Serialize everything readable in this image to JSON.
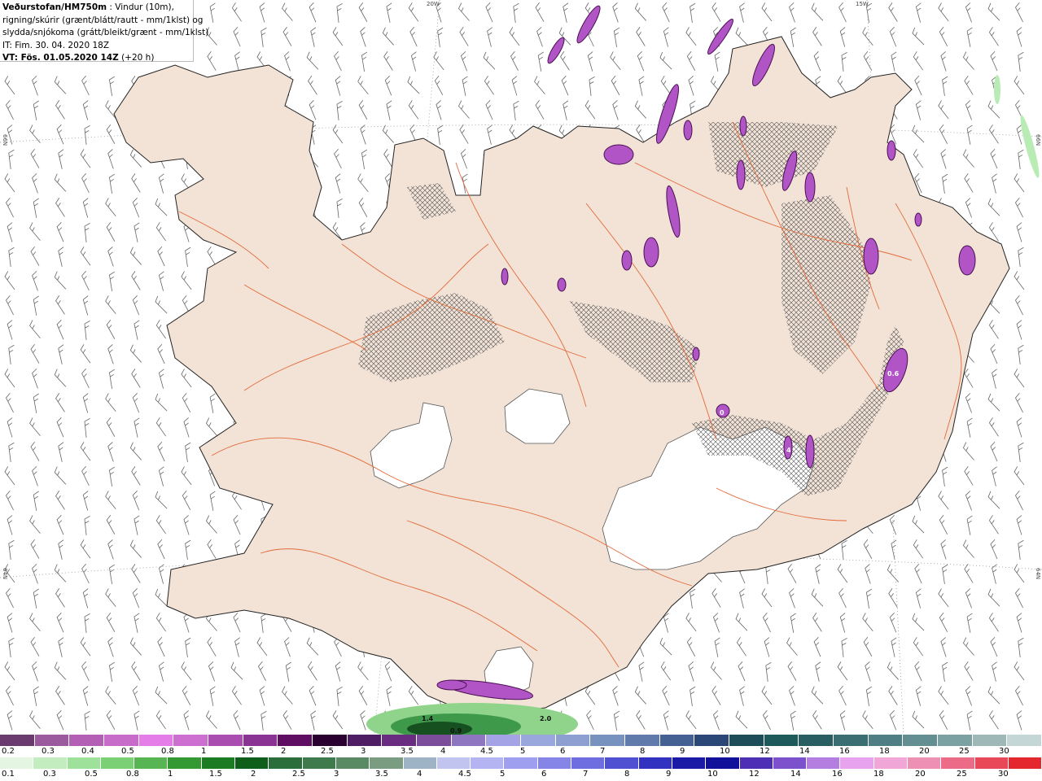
{
  "header": {
    "title": "Veðurstofan/HM750m",
    "title_rest": " : Vindur (10m),",
    "line2": "rigning/skúrir (grænt/blátt/rautt - mm/1klst) og",
    "line3": "slydda/snjókoma (grátt/bleikt/grænt - mm/1klst)",
    "line4": "IT: Fim. 30. 04. 2020 18Z",
    "line5_bold": "VT: Fös. 01.05.2020 14Z",
    "line5_rest": " (+20 h)"
  },
  "coords": {
    "lon20": "20W",
    "lon15": "15W",
    "lat66_left": "66N",
    "lat66_right": "66N",
    "lat64_left": "64N",
    "lat64_right": "64N"
  },
  "map_labels": [
    "1.4",
    "0.9",
    "2.0",
    "0.6",
    "0",
    "4"
  ],
  "legend_snow": {
    "colors": [
      "#6b3a6e",
      "#9c5a9e",
      "#b35fb6",
      "#c86cc9",
      "#e47de8",
      "#cc6fd0",
      "#a94eb0",
      "#8b3394",
      "#5e0d62",
      "#2a0030",
      "#4f1d63",
      "#6a2c80",
      "#7c4d9a",
      "#8e77c0",
      "#a3a3e6",
      "#9aa7dc",
      "#8d9fd0",
      "#7892c0",
      "#5f7aab",
      "#445f92",
      "#2b4778",
      "#1d4d58",
      "#1e5a5c",
      "#295f62",
      "#3b6e73",
      "#4f7f84",
      "#648f92",
      "#7ba1a3",
      "#9eb8b8",
      "#c4d6d6"
    ],
    "labels": [
      "0.2",
      "0.3",
      "0.4",
      "0.5",
      "0.8",
      "1",
      "1.5",
      "2",
      "2.5",
      "3",
      "3.5",
      "4",
      "4.5",
      "5",
      "6",
      "7",
      "8",
      "9",
      "10",
      "12",
      "14",
      "16",
      "18",
      "20",
      "25",
      "30"
    ]
  },
  "legend_rain": {
    "colors": [
      "#e4f5e1",
      "#c3ecbf",
      "#9ee19a",
      "#7bd076",
      "#58b553",
      "#349833",
      "#1d7c23",
      "#0f5e1a",
      "#2b6e3c",
      "#3f7a4d",
      "#5a8a64",
      "#7a9c80",
      "#9fb3c6",
      "#c0c4ef",
      "#b4b4f2",
      "#9f9ff0",
      "#8585e8",
      "#6e6ee0",
      "#5050d2",
      "#3232c0",
      "#1a1aa6",
      "#10109a",
      "#4c2fb5",
      "#7e51cc",
      "#b37ee0",
      "#e7a3ee",
      "#f0a6d7",
      "#ee8fb4",
      "#ec6c88",
      "#e84858",
      "#e4272e"
    ],
    "labels": [
      "0.1",
      "0.3",
      "0.5",
      "0.8",
      "1",
      "1.5",
      "2",
      "2.5",
      "3",
      "3.5",
      "4",
      "4.5",
      "5",
      "6",
      "7",
      "8",
      "9",
      "10",
      "12",
      "14",
      "16",
      "18",
      "20",
      "25",
      "30"
    ]
  }
}
